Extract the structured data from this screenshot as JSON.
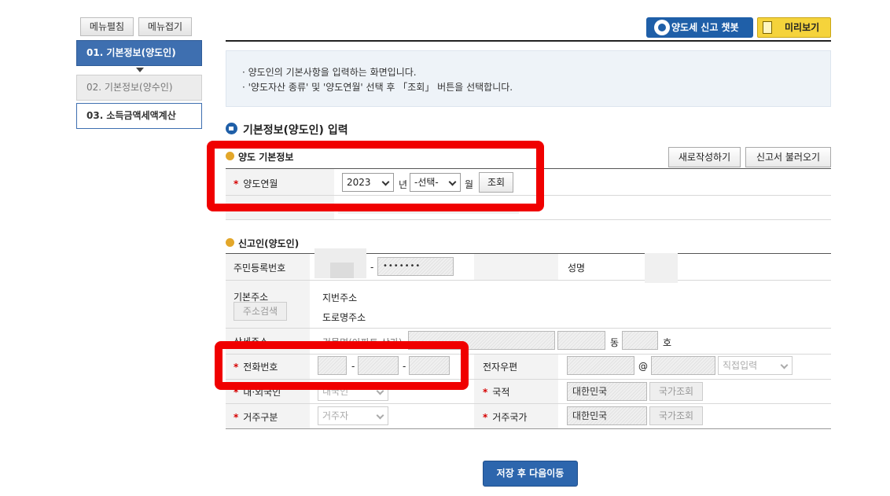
{
  "left_menu": {
    "expand_label": "메뉴펼침",
    "collapse_label": "메뉴접기",
    "steps": [
      {
        "label": "01. 기본정보(양도인)"
      },
      {
        "label": "02. 기본정보(양수인)"
      },
      {
        "label": "03. 소득금액세액계산"
      }
    ]
  },
  "header": {
    "chatbot_label": "양도세 신고 챗봇",
    "preview_label": "미리보기"
  },
  "info": {
    "lines": [
      "· 양도인의 기본사항을 입력하는 화면입니다.",
      "· '양도자산 종류' 및 '양도연월' 선택 후 「조회」 버튼을 선택합니다."
    ]
  },
  "section_title": "기본정보(양도인) 입력",
  "transfer_basic": {
    "title": "양도 기본정보",
    "new_label": "새로작성하기",
    "load_label": "신고서 불러오기",
    "required_mark": "*",
    "year_month_label": "양도연월",
    "year_value": "2023",
    "year_unit": "년",
    "month_value": "-선택-",
    "month_unit": "월",
    "query_label": "조회"
  },
  "reporter": {
    "title": "신고인(양도인)",
    "rrn_label": "주민등록번호",
    "rrn_dash": "-",
    "rrn_back": "•••••••",
    "name_label": "성명",
    "address_label": "기본주소",
    "address_search_label": "주소검색",
    "jibun_label": "지번주소",
    "road_label": "도로명주소",
    "detail_label": "상세주소",
    "building_placeholder": "건물명(아파트,상가)",
    "dong_unit": "동",
    "ho_unit": "호",
    "phone_label": "전화번호",
    "phone_dash": "-",
    "email_label": "전자우편",
    "email_at": "@",
    "email_domain_select": "직접입력",
    "domestic_label": "내·외국인",
    "domestic_value": "내국인",
    "nationality_label": "국적",
    "nationality_value": "대한민국",
    "country_query_label": "국가조회",
    "residence_type_label": "거주구분",
    "residence_type_value": "거주자",
    "residence_country_label": "거주국가",
    "residence_country_value": "대한민국"
  },
  "footer": {
    "save_next_label": "저장 후 다음이동"
  },
  "colors": {
    "primary": "#1f5fa8",
    "active_step": "#3e6fb0",
    "highlight_box": "#f00000",
    "preview_yellow": "#f5d33b"
  }
}
